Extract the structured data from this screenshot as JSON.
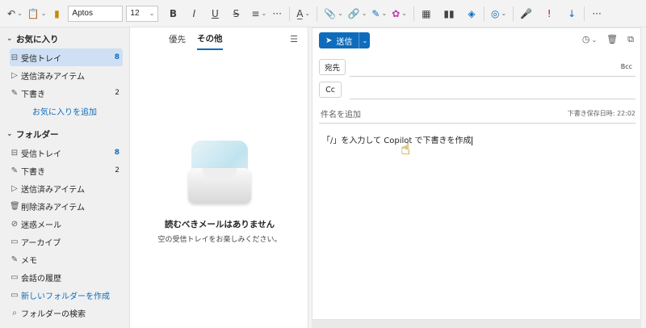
{
  "toolbar": {
    "font_name": "Aptos",
    "font_size": "12",
    "bold": "B",
    "italic": "I",
    "underline": "U",
    "strike": "S",
    "more": "···"
  },
  "nav": {
    "favorites": {
      "header": "お気に入り",
      "items": [
        {
          "label": "受信トレイ",
          "count": "8",
          "icon": "inbox-icon"
        },
        {
          "label": "送信済みアイテム",
          "count": "",
          "icon": "sent-icon"
        },
        {
          "label": "下書き",
          "count": "2",
          "icon": "draft-icon"
        }
      ],
      "add_link": "お気に入りを追加"
    },
    "folders": {
      "header": "フォルダー",
      "items": [
        {
          "label": "受信トレイ",
          "count": "8",
          "icon": "inbox-icon"
        },
        {
          "label": "下書き",
          "count": "2",
          "icon": "draft-icon"
        },
        {
          "label": "送信済みアイテム",
          "count": "",
          "icon": "sent-icon"
        },
        {
          "label": "削除済みアイテム",
          "count": "",
          "icon": "trash-icon"
        },
        {
          "label": "迷惑メール",
          "count": "",
          "icon": "junk-icon"
        },
        {
          "label": "アーカイブ",
          "count": "",
          "icon": "archive-icon"
        },
        {
          "label": "メモ",
          "count": "",
          "icon": "note-icon"
        },
        {
          "label": "会話の履歴",
          "count": "",
          "icon": "folder-icon"
        }
      ],
      "new_folder": "新しいフォルダーを作成",
      "search_folder": "フォルダーの検索"
    }
  },
  "list": {
    "tab_focused": "優先",
    "tab_other": "その他",
    "empty_title": "読むべきメールはありません",
    "empty_sub": "空の受信トレイをお楽しみください。"
  },
  "compose": {
    "send": "送信",
    "to": "宛先",
    "cc": "Cc",
    "bcc": "Bcc",
    "subject_placeholder": "件名を追加",
    "saved": "下書き保存日時: 22:02",
    "body_placeholder": "「/」を入力して Copilot で下書きを作成"
  }
}
